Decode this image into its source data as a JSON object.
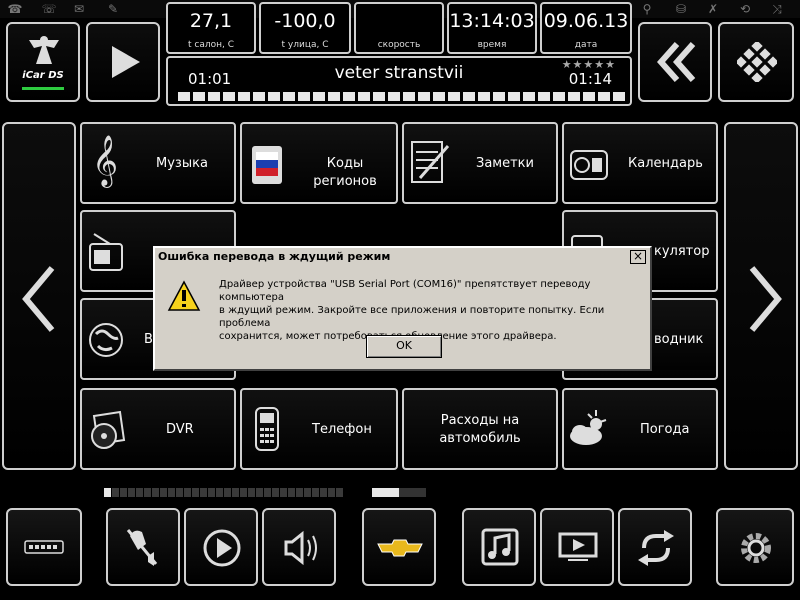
{
  "app": {
    "logo_text": "iCar DS"
  },
  "info": [
    {
      "value": "27,1",
      "label": "t салон, С"
    },
    {
      "value": "-100,0",
      "label": "t улица, С"
    },
    {
      "value": "",
      "label": "скорость"
    },
    {
      "value": "13:14:03",
      "label": "время"
    },
    {
      "value": "09.06.13",
      "label": "дата"
    }
  ],
  "player": {
    "title": "veter stranstvii",
    "elapsed": "01:01",
    "total": "01:14",
    "rating_text": "★★★★★",
    "progress": 1.0
  },
  "menu": [
    {
      "label": "Музыка",
      "icon": "treble-clef-icon"
    },
    {
      "label": "Коды регионов",
      "icon": "russian-flag-icon"
    },
    {
      "label": "Заметки",
      "icon": "notes-icon"
    },
    {
      "label": "Календарь",
      "icon": "calendar-icon"
    },
    {
      "label": "",
      "icon": "radio-icon"
    },
    {
      "label": "кулятор",
      "icon": "calculator-icon"
    },
    {
      "label": "В",
      "icon": "globe-icon"
    },
    {
      "label": "водник",
      "icon": "navigator-icon"
    },
    {
      "label": "DVR",
      "icon": "dvr-disc-icon"
    },
    {
      "label": "Телефон",
      "icon": "phone-icon"
    },
    {
      "label": "Расходы на",
      "label2": "автомобиль",
      "icon": ""
    },
    {
      "label": "Погода",
      "icon": "weather-icon"
    }
  ],
  "dialog": {
    "title": "Ошибка перевода в ждущий режим",
    "line1": "Драйвер устройства \"USB Serial Port (COM16)\" препятствует переводу компьютера",
    "line2": "в ждущий режим. Закройте все приложения и повторите попытку. Если проблема",
    "line3": "сохранится, может потребоваться обновление этого драйвера.",
    "ok": "OK"
  },
  "volume": {
    "level": 0.04,
    "aux_level": 0.5
  },
  "colors": {
    "border": "#cfcfcf",
    "dialog_bg": "#d4d0c8",
    "warn_yellow": "#f6d21c"
  }
}
